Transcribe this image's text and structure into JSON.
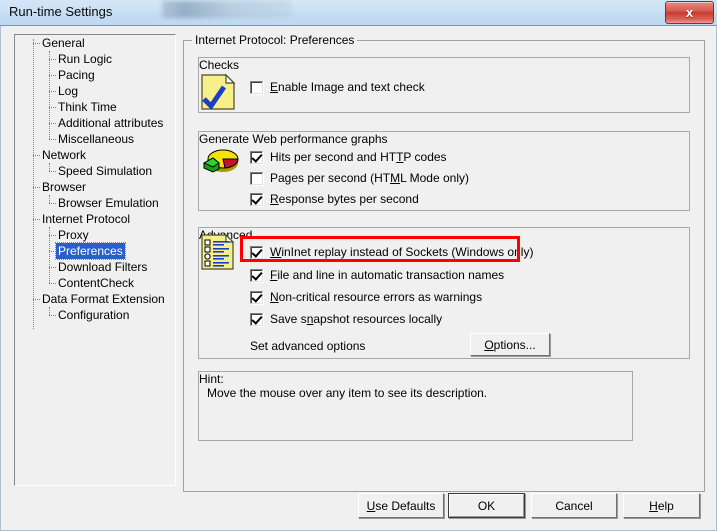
{
  "window": {
    "title": "Run-time Settings",
    "close_label": "x"
  },
  "tree": {
    "items": [
      {
        "label": "General",
        "level": 1,
        "selected": false
      },
      {
        "label": "Run Logic",
        "level": 2,
        "selected": false
      },
      {
        "label": "Pacing",
        "level": 2,
        "selected": false
      },
      {
        "label": "Log",
        "level": 2,
        "selected": false
      },
      {
        "label": "Think Time",
        "level": 2,
        "selected": false
      },
      {
        "label": "Additional attributes",
        "level": 2,
        "selected": false
      },
      {
        "label": "Miscellaneous",
        "level": 2,
        "selected": false
      },
      {
        "label": "Network",
        "level": 1,
        "selected": false
      },
      {
        "label": "Speed Simulation",
        "level": 2,
        "selected": false
      },
      {
        "label": "Browser",
        "level": 1,
        "selected": false
      },
      {
        "label": "Browser Emulation",
        "level": 2,
        "selected": false
      },
      {
        "label": "Internet Protocol",
        "level": 1,
        "selected": false
      },
      {
        "label": "Proxy",
        "level": 2,
        "selected": false
      },
      {
        "label": "Preferences",
        "level": 2,
        "selected": true
      },
      {
        "label": "Download Filters",
        "level": 2,
        "selected": false
      },
      {
        "label": "ContentCheck",
        "level": 2,
        "selected": false
      },
      {
        "label": "Data Format Extension",
        "level": 1,
        "selected": false
      },
      {
        "label": "Configuration",
        "level": 2,
        "selected": false
      }
    ]
  },
  "main": {
    "title": "Internet Protocol: Preferences",
    "checks": {
      "title": "Checks",
      "icon": "yellow-page-check-icon",
      "options": [
        {
          "label_pre": "",
          "label_key": "E",
          "label_post": "nable Image and text check",
          "checked": false
        }
      ]
    },
    "graphs": {
      "title": "Generate Web performance graphs",
      "icon": "pie-chart-icon",
      "options": [
        {
          "label_pre": "Hits per second and HT",
          "label_key": "T",
          "label_post": "P codes",
          "checked": true
        },
        {
          "label_pre": "Pages per second (HT",
          "label_key": "M",
          "label_post": "L Mode only)",
          "checked": false
        },
        {
          "label_pre": "",
          "label_key": "R",
          "label_post": "esponse bytes per second",
          "checked": true
        }
      ]
    },
    "advanced": {
      "title": "Advanced",
      "icon": "yellow-document-list-icon",
      "options": [
        {
          "label_pre": "",
          "label_key": "W",
          "label_post": "inInet replay instead of Sockets (Windows only)",
          "checked": true,
          "highlighted": true
        },
        {
          "label_pre": "",
          "label_key": "F",
          "label_post": "ile and line in automatic transaction names",
          "checked": true,
          "highlighted": false
        },
        {
          "label_pre": "",
          "label_key": "N",
          "label_post": "on-critical resource errors as warnings",
          "checked": true,
          "highlighted": false
        },
        {
          "label_pre": "Save s",
          "label_key": "n",
          "label_post": "apshot resources locally",
          "checked": true,
          "highlighted": false
        }
      ],
      "set_options_text": "Set advanced options",
      "options_button": {
        "pre": "",
        "key": "O",
        "post": "ptions..."
      }
    },
    "hint": {
      "title": "Hint:",
      "body": "Move the mouse over any item to see its description."
    }
  },
  "footer": {
    "buttons": [
      {
        "pre": "",
        "key": "U",
        "post": "se Defaults",
        "default": false
      },
      {
        "pre": "OK",
        "key": "",
        "post": "",
        "default": true
      },
      {
        "pre": "Cancel",
        "key": "",
        "post": "",
        "default": false
      },
      {
        "pre": "",
        "key": "H",
        "post": "elp",
        "default": false
      }
    ]
  },
  "colors": {
    "highlight_red": "#ff0000",
    "selection_blue": "#2a5fc8",
    "dialog_face": "#f0f0f0"
  }
}
